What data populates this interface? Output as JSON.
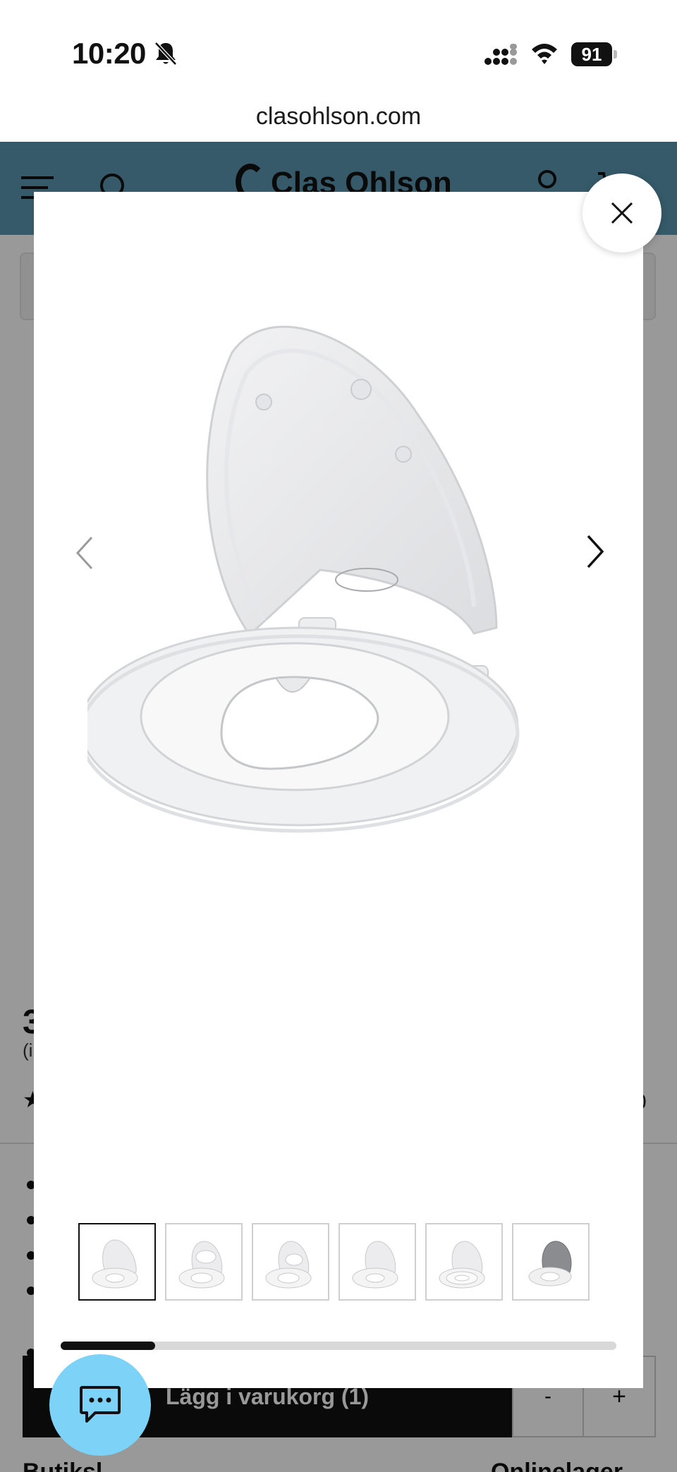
{
  "status_bar": {
    "time": "10:20",
    "battery": "91",
    "bell_icon": "bell-slash-icon"
  },
  "browser": {
    "url": "clasohlson.com"
  },
  "site_header": {
    "brand": "Clas Ohlson",
    "color": "#5b97b0",
    "icons": [
      "menu-icon",
      "search-icon",
      "user-icon",
      "cart-icon"
    ]
  },
  "background_page": {
    "price_partial": "3",
    "price_note_partial": "(i",
    "rating_partial": "0",
    "add_to_cart_label": "Lägg i varukorg (1)",
    "qty_minus": "-",
    "qty_plus": "+",
    "footer_left": "Butiksl",
    "footer_right": "Onlinelager"
  },
  "gallery_modal": {
    "close_icon": "close-icon",
    "prev_icon": "chevron-left-icon",
    "next_icon": "chevron-right-icon",
    "main_image": "toilet-seat-with-child-seat",
    "thumbnail_count": 6,
    "selected_thumbnail": 1,
    "scroll_progress": 0.17
  },
  "chat": {
    "icon": "chat-bubble-icon",
    "color": "#7dd3f7"
  }
}
